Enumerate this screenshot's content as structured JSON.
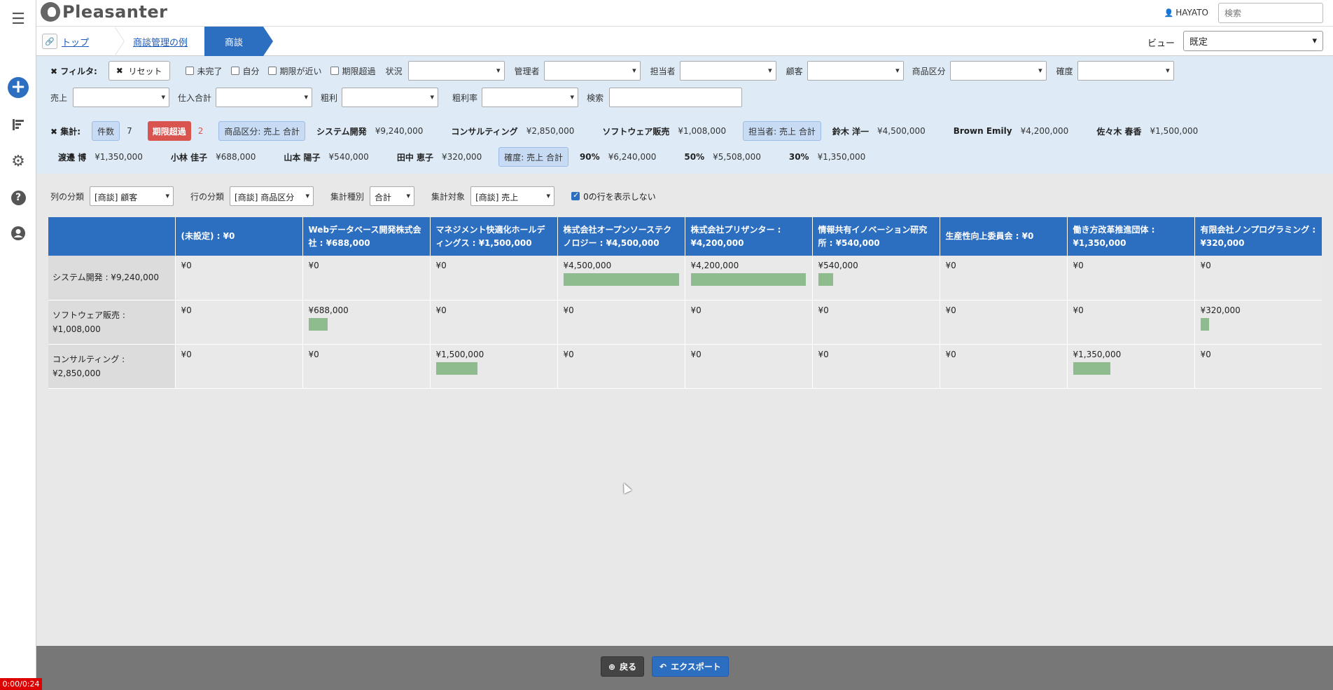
{
  "app": {
    "logo_text": "Pleasanter",
    "user": "HAYATO",
    "search_placeholder": "検索"
  },
  "breadcrumb": {
    "top": "トップ",
    "mid": "商談管理の例",
    "active": "商談"
  },
  "view": {
    "label": "ビュー",
    "selected": "既定"
  },
  "filters": {
    "title": "フィルタ:",
    "reset": "リセット",
    "checkboxes": [
      "未完了",
      "自分",
      "期限が近い",
      "期限超過"
    ],
    "row1_labels": [
      "状況",
      "管理者",
      "担当者",
      "顧客",
      "商品区分",
      "確度"
    ],
    "row2_labels": [
      "売上",
      "仕入合計",
      "粗利",
      "粗利率",
      "検索"
    ]
  },
  "aggregation": {
    "title": "集計:",
    "count_label": "件数",
    "count_value": "7",
    "overdue_label": "期限超過",
    "overdue_value": "2",
    "group1_label": "商品区分: 売上 合計",
    "group1_items": [
      {
        "name": "システム開発",
        "value": "¥9,240,000"
      },
      {
        "name": "コンサルティング",
        "value": "¥2,850,000"
      },
      {
        "name": "ソフトウェア販売",
        "value": "¥1,008,000"
      }
    ],
    "group2_label": "担当者: 売上 合計",
    "group2_items_a": [
      {
        "name": "鈴木 洋一",
        "value": "¥4,500,000"
      },
      {
        "name": "Brown Emily",
        "value": "¥4,200,000"
      },
      {
        "name": "佐々木 春香",
        "value": "¥1,500,000"
      }
    ],
    "group2_items_b": [
      {
        "name": "渡邊 博",
        "value": "¥1,350,000"
      },
      {
        "name": "小林 佳子",
        "value": "¥688,000"
      },
      {
        "name": "山本 陽子",
        "value": "¥540,000"
      },
      {
        "name": "田中 恵子",
        "value": "¥320,000"
      }
    ],
    "group3_label": "確度: 売上 合計",
    "group3_items": [
      {
        "name": "90%",
        "value": "¥6,240,000"
      },
      {
        "name": "50%",
        "value": "¥5,508,000"
      },
      {
        "name": "30%",
        "value": "¥1,350,000"
      }
    ]
  },
  "controls": {
    "col_label": "列の分類",
    "col_value": "[商談] 顧客",
    "row_label": "行の分類",
    "row_value": "[商談] 商品区分",
    "agg_type_label": "集計種別",
    "agg_type_value": "合計",
    "target_label": "集計対象",
    "target_value": "[商談] 売上",
    "hide_zero": "0の行を表示しない"
  },
  "grid": {
    "columns": [
      "(未設定) : ¥0",
      "Webデータベース開発株式会社 : ¥688,000",
      "マネジメント快適化ホールディングス : ¥1,500,000",
      "株式会社オープンソーステクノロジー : ¥4,500,000",
      "株式会社プリザンター : ¥4,200,000",
      "情報共有イノベーション研究所 : ¥540,000",
      "生産性向上委員会 : ¥0",
      "働き方改革推進団体 : ¥1,350,000",
      "有限会社ノンプログラミング : ¥320,000"
    ],
    "rows": [
      {
        "head": "システム開発 : ¥9,240,000",
        "cells": [
          "¥0",
          "¥0",
          "¥0",
          "¥4,500,000",
          "¥4,200,000",
          "¥540,000",
          "¥0",
          "¥0",
          "¥0"
        ],
        "amounts": [
          0,
          0,
          0,
          4500000,
          4200000,
          540000,
          0,
          0,
          0
        ]
      },
      {
        "head": "ソフトウェア販売 : ¥1,008,000",
        "cells": [
          "¥0",
          "¥688,000",
          "¥0",
          "¥0",
          "¥0",
          "¥0",
          "¥0",
          "¥0",
          "¥320,000"
        ],
        "amounts": [
          0,
          688000,
          0,
          0,
          0,
          0,
          0,
          0,
          320000
        ]
      },
      {
        "head": "コンサルティング : ¥2,850,000",
        "cells": [
          "¥0",
          "¥0",
          "¥1,500,000",
          "¥0",
          "¥0",
          "¥0",
          "¥0",
          "¥1,350,000",
          "¥0"
        ],
        "amounts": [
          0,
          0,
          1500000,
          0,
          0,
          0,
          0,
          1350000,
          0
        ]
      }
    ]
  },
  "footer": {
    "back": "戻る",
    "export": "エクスポート"
  },
  "timer": "0:00/0:24"
}
